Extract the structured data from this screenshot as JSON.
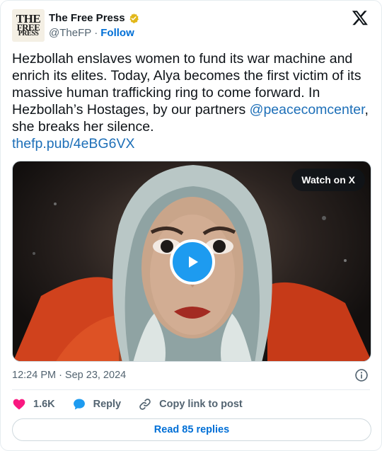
{
  "author": {
    "avatar_text": [
      "THE",
      "FREE",
      "PRESS"
    ],
    "display_name": "The Free Press",
    "handle": "@TheFP",
    "separator": "·",
    "follow_label": "Follow"
  },
  "brand_logo": "x-logo-icon",
  "tweet": {
    "text_before_mention": "Hezbollah enslaves women to fund its war machine and enrich its elites. Today, Alya becomes the first victim of its massive human trafficking ring to come forward. In Hezbollah’s Hostages, by our partners ",
    "mention": "@peacecomcenter",
    "text_after_mention": ", she breaks her silence.",
    "link": "thefp.pub/4eBG6VX"
  },
  "media": {
    "watch_label": "Watch on X",
    "play_icon": "play-icon"
  },
  "meta": {
    "time": "12:24 PM",
    "separator": "·",
    "date": "Sep 23, 2024",
    "info_icon": "info-icon"
  },
  "actions": {
    "like_count": "1.6K",
    "reply_label": "Reply",
    "copy_link_label": "Copy link to post"
  },
  "read_replies_label": "Read 85 replies",
  "colors": {
    "link": "#1d6fb8",
    "follow": "#006fd6",
    "like_heart": "#f91880",
    "reply_bubble": "#1d9bf0",
    "play_button": "#1d9bf0",
    "verified_badge": "#e2b719"
  }
}
